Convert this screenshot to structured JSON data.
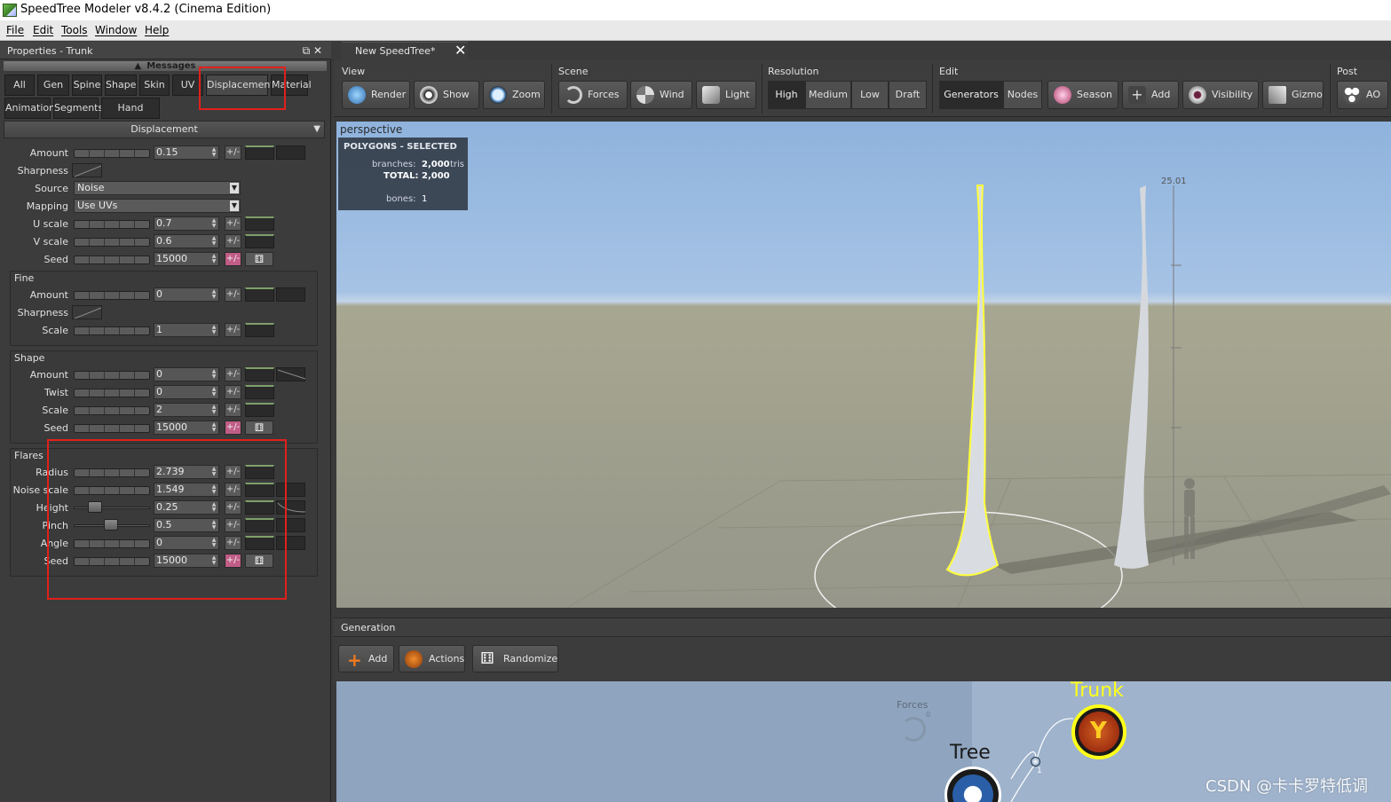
{
  "window": {
    "title": "SpeedTree Modeler v8.4.2 (Cinema Edition)"
  },
  "menu": [
    "File",
    "Edit",
    "Tools",
    "Window",
    "Help"
  ],
  "properties": {
    "title": "Properties - Trunk",
    "window_buttons": "⧉ ✕",
    "messages": "Messages",
    "tabs_row1": [
      "All",
      "Gen",
      "Spine",
      "Shape",
      "Skin",
      "UV",
      "Displacement",
      "Material"
    ],
    "tabs_row2": [
      "Animation",
      "Segments",
      "Hand Drawn"
    ],
    "section": "Displacement",
    "main": {
      "amount": {
        "label": "Amount",
        "value": "0.15"
      },
      "sharpness": {
        "label": "Sharpness"
      },
      "source": {
        "label": "Source",
        "value": "Noise"
      },
      "mapping": {
        "label": "Mapping",
        "value": "Use UVs"
      },
      "uscale": {
        "label": "U scale",
        "value": "0.7"
      },
      "vscale": {
        "label": "V scale",
        "value": "0.6"
      },
      "seed": {
        "label": "Seed",
        "value": "15000"
      }
    },
    "fine": {
      "title": "Fine",
      "amount": {
        "label": "Amount",
        "value": "0"
      },
      "sharpness": {
        "label": "Sharpness"
      },
      "scale": {
        "label": "Scale",
        "value": "1"
      }
    },
    "shape": {
      "title": "Shape",
      "amount": {
        "label": "Amount",
        "value": "0"
      },
      "twist": {
        "label": "Twist",
        "value": "0"
      },
      "scale": {
        "label": "Scale",
        "value": "2"
      },
      "seed": {
        "label": "Seed",
        "value": "15000"
      }
    },
    "flares": {
      "title": "Flares",
      "radius": {
        "label": "Radius",
        "value": "2.739"
      },
      "noise_scale": {
        "label": "Noise scale",
        "value": "1.549"
      },
      "height": {
        "label": "Height",
        "value": "0.25"
      },
      "pinch": {
        "label": "Pinch",
        "value": "0.5"
      },
      "angle": {
        "label": "Angle",
        "value": "0"
      },
      "seed": {
        "label": "Seed",
        "value": "15000"
      }
    },
    "pm_label": "+/-"
  },
  "document_tab": {
    "label": "New SpeedTree*",
    "close": "✕"
  },
  "toolbar": {
    "view": {
      "label": "View",
      "buttons": [
        "Render",
        "Show",
        "Zoom"
      ]
    },
    "scene": {
      "label": "Scene",
      "buttons": [
        "Forces",
        "Wind",
        "Light"
      ]
    },
    "resolution": {
      "label": "Resolution",
      "options": [
        "High",
        "Medium",
        "Low",
        "Draft"
      ],
      "selected": "High"
    },
    "edit": {
      "label": "Edit",
      "options": [
        "Generators",
        "Nodes"
      ],
      "selected": "Generators",
      "buttons": [
        "Season",
        "Add",
        "Visibility",
        "Gizmo"
      ]
    },
    "post": {
      "label": "Post",
      "buttons": [
        "AO"
      ]
    }
  },
  "viewport": {
    "label": "perspective",
    "stats": {
      "heading": "POLYGONS - SELECTED",
      "branches_label": "branches:",
      "branches_value": "2,000",
      "branches_unit": "tris",
      "total_label": "TOTAL:",
      "total_value": "2,000",
      "bones_label": "bones:",
      "bones_value": "1"
    },
    "ruler_value": "25.01"
  },
  "generation": {
    "title": "Generation",
    "buttons": [
      "Add",
      "Actions",
      "Randomize"
    ]
  },
  "nodes": {
    "forces_label": "Forces",
    "forces_count": "0",
    "tree_label": "Tree",
    "trunk_label": "Trunk",
    "link_count": "1"
  },
  "watermark": "CSDN @卡卡罗特低调",
  "colors": {
    "selection_highlight": "#ffff3c",
    "annotation_red": "#e0201c",
    "pink_toggle": "#c05d86"
  }
}
